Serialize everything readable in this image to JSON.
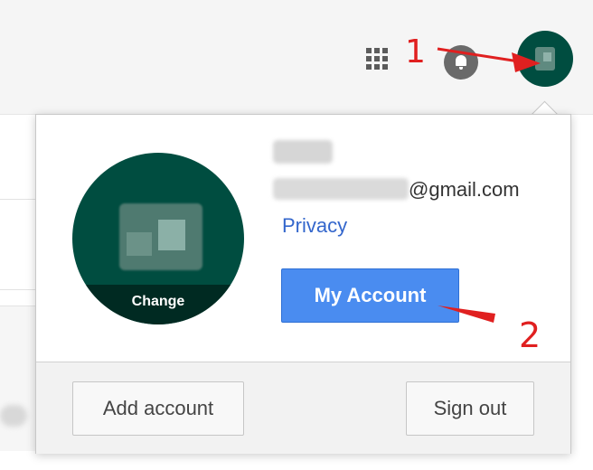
{
  "header": {
    "icons": [
      "apps-grid-icon",
      "notifications-bell-icon"
    ],
    "annotation_1": "1"
  },
  "account_popup": {
    "avatar_change_label": "Change",
    "email_suffix": "@gmail.com",
    "privacy_link": "Privacy",
    "my_account_button": "My Account",
    "annotation_2": "2",
    "footer": {
      "add_account_button": "Add account",
      "sign_out_button": "Sign out"
    }
  },
  "colors": {
    "avatar_green": "#004d40",
    "primary_button": "#4a8cf0",
    "link": "#3366cc",
    "annotation_red": "#e02020"
  }
}
